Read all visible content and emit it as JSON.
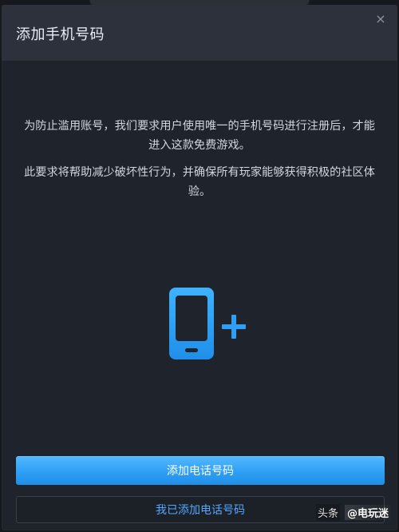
{
  "dialog": {
    "title": "添加手机号码",
    "close_icon": "close-icon",
    "message_1": "为防止滥用账号，我们要求用户使用唯一的手机号码进行注册后，才能进入这款免费游戏。",
    "message_2": "此要求将帮助减少破坏性行为，并确保所有玩家能够获得积极的社区体验。",
    "primary_button_label": "添加电话号码",
    "secondary_button_label": "我已添加电话号码",
    "icon": "phone-plus-icon",
    "accent_color": "#2f9ff5"
  },
  "watermark": {
    "source": "头条",
    "author": "@电玩迷"
  }
}
